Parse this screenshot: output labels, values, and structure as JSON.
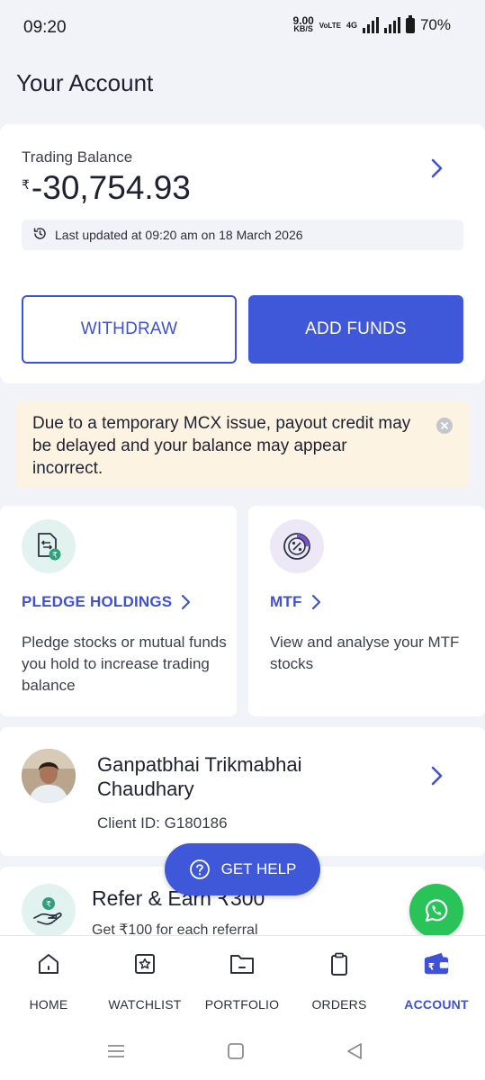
{
  "status_bar": {
    "time": "09:20",
    "net_speed": "9.00",
    "net_unit": "KB/S",
    "volte": "VoLTE",
    "network": "4G",
    "battery": "70%"
  },
  "page_title": "Your Account",
  "balance": {
    "label": "Trading Balance",
    "currency": "₹",
    "amount": "-30,754.93",
    "last_updated": "Last updated at 09:20 am on 18 March 2026",
    "withdraw_label": "WITHDRAW",
    "add_funds_label": "ADD FUNDS"
  },
  "notice": {
    "text": "Due to a temporary MCX issue, payout credit may be delayed and your balance may appear incorrect."
  },
  "features": [
    {
      "title": "PLEDGE HOLDINGS",
      "description": "Pledge stocks or mutual funds you hold to increase trading balance",
      "icon": "pledge-icon"
    },
    {
      "title": "MTF",
      "description": "View and analyse your MTF stocks",
      "icon": "mtf-percent-icon"
    }
  ],
  "profile": {
    "name": "Ganpatbhai Trikmabhai Chaudhary",
    "client_id": "Client ID: G180186"
  },
  "refer": {
    "title": "Refer & Earn ₹300",
    "subtitle": "Get ₹100 for each referral"
  },
  "get_help_label": "GET HELP",
  "bottom_nav": [
    {
      "label": "HOME",
      "icon": "home-icon",
      "active": false
    },
    {
      "label": "WATCHLIST",
      "icon": "watchlist-icon",
      "active": false
    },
    {
      "label": "PORTFOLIO",
      "icon": "portfolio-icon",
      "active": false
    },
    {
      "label": "ORDERS",
      "icon": "orders-icon",
      "active": false
    },
    {
      "label": "ACCOUNT",
      "icon": "account-wallet-icon",
      "active": true
    }
  ],
  "colors": {
    "accent": "#3f57d9",
    "background": "#f1f3f8",
    "notice_bg": "#fdf3e3",
    "whatsapp": "#29c35a"
  }
}
